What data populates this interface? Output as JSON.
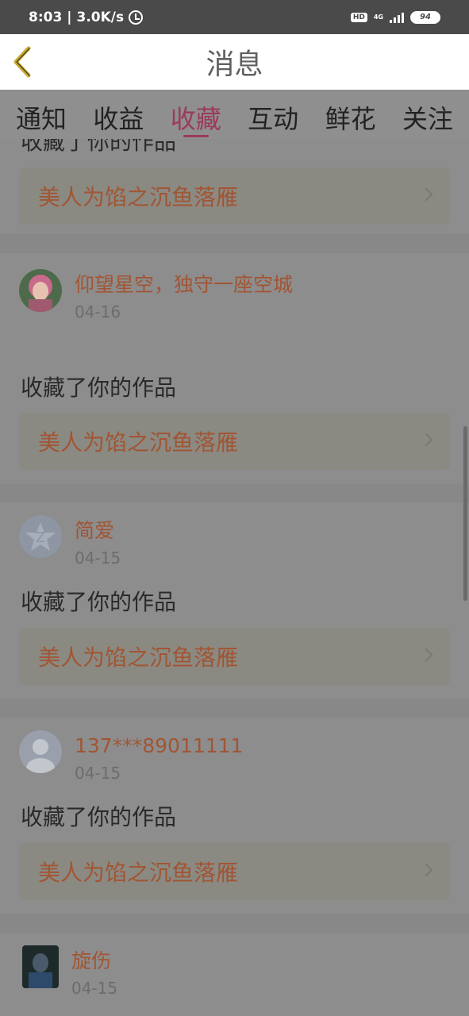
{
  "status_bar": {
    "time": "8:03",
    "speed": "3.0K/s",
    "hd": "HD",
    "network": "4G",
    "battery": "94"
  },
  "header": {
    "title": "消息"
  },
  "tabs": [
    {
      "label": "通知"
    },
    {
      "label": "收益"
    },
    {
      "label": "收藏"
    },
    {
      "label": "互动"
    },
    {
      "label": "鲜花"
    },
    {
      "label": "关注"
    }
  ],
  "active_tab": "收藏",
  "partial_item": {
    "action_text": "收藏了你的作品",
    "work_title": "美人为馅之沉鱼落雁"
  },
  "items": [
    {
      "user": "仰望星空，独守一座空城",
      "date": "04-16",
      "action": "收藏了你的作品",
      "work": "美人为馅之沉鱼落雁"
    },
    {
      "user": "简爱",
      "date": "04-15",
      "action": "收藏了你的作品",
      "work": "美人为馅之沉鱼落雁"
    },
    {
      "user": "137***89011111",
      "date": "04-15",
      "action": "收藏了你的作品",
      "work": "美人为馅之沉鱼落雁"
    },
    {
      "user": "旋伤",
      "date": "04-15"
    }
  ],
  "colors": {
    "accent": "#9b3a5a",
    "username": "#a15534",
    "overlay": "#8f8f8f"
  }
}
